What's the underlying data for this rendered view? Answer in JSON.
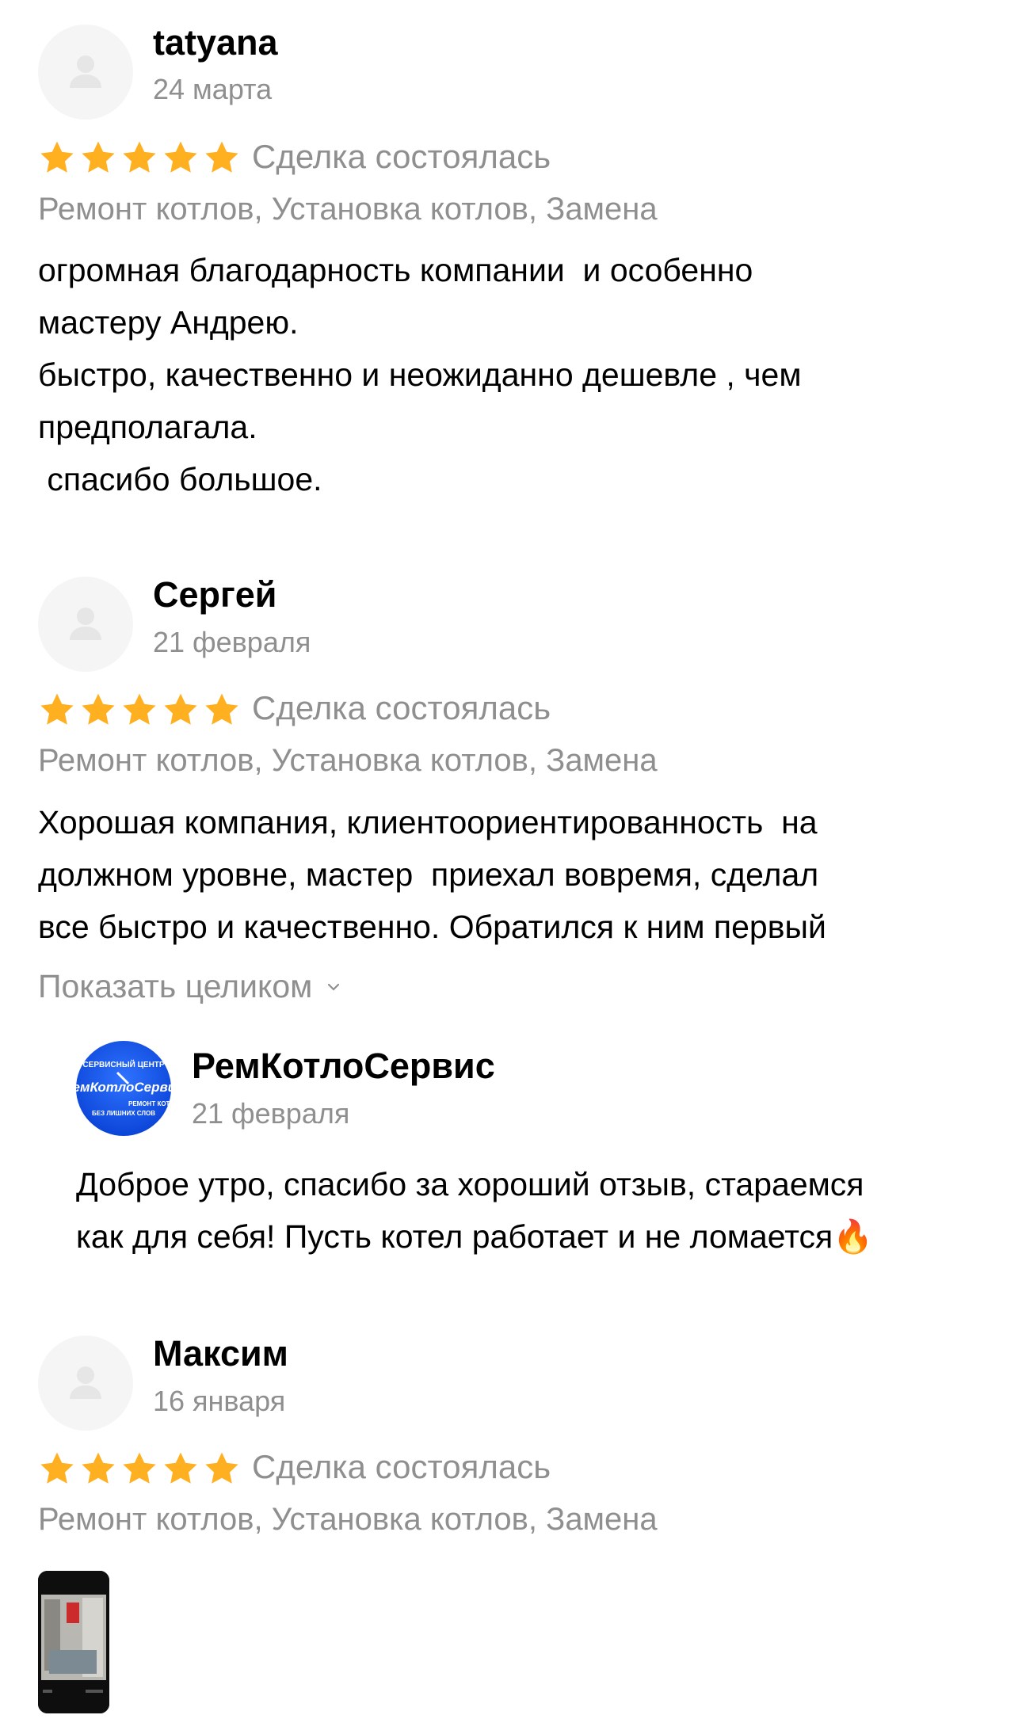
{
  "reviews": [
    {
      "author": "tatyana",
      "date": "24 марта",
      "rating": 5,
      "status": "Сделка состоялась",
      "services": "Ремонт котлов, Установка котлов, Замена",
      "text": "огромная благодарность компании  и особенно\nмастеру Андрею.\nбыстро, качественно и неожиданно дешевле , чем\nпредполагала.\n спасибо большое."
    },
    {
      "author": "Сергей",
      "date": "21 февраля",
      "rating": 5,
      "status": "Сделка состоялась",
      "services": "Ремонт котлов, Установка котлов, Замена",
      "text": "Хорошая компания, клиентоориентированность  на\nдолжном уровне, мастер  приехал вовремя, сделал\nвсе быстро и качественно. Обратился к ним первый",
      "show_more": "Показать целиком",
      "reply": {
        "company": "РемКотлоСервис",
        "logo_top": "СЕРВИСНЫЙ ЦЕНТР",
        "logo_main": "РемКотлоСервис",
        "logo_bottom1": "РЕМОНТ КОТЛОВ",
        "logo_bottom2": "БЕЗ ЛИШНИХ СЛОВ",
        "date": "21 февраля",
        "text": "Доброе утро, спасибо за хороший отзыв, стараемся\nкак для себя! Пусть котел работает и не ломается🔥"
      }
    },
    {
      "author": "Максим",
      "date": "16 января",
      "rating": 5,
      "status": "Сделка состоялась",
      "services": "Ремонт котлов, Установка котлов, Замена"
    }
  ],
  "colors": {
    "star": "#FFB021",
    "muted": "#8f8f8f",
    "logo_blue": "#1a55ee"
  },
  "icons": {
    "avatar": "user-placeholder-icon",
    "star": "star-icon",
    "chevron": "chevron-down-icon",
    "flame": "fire-emoji"
  }
}
